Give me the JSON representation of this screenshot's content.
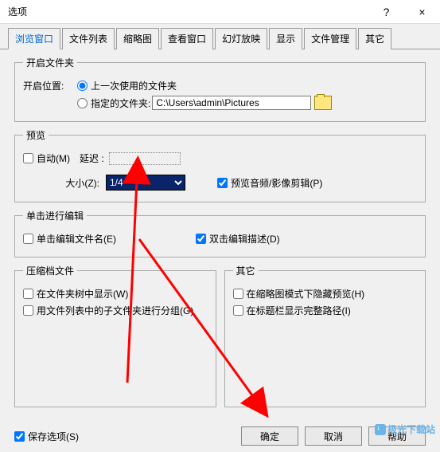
{
  "window": {
    "title": "选项",
    "help": "?",
    "close": "×"
  },
  "tabs": [
    "浏览窗口",
    "文件列表",
    "缩略图",
    "查看窗口",
    "幻灯放映",
    "显示",
    "文件管理",
    "其它"
  ],
  "folder": {
    "legend": "开启文件夹",
    "location_label": "开启位置:",
    "opt_last": "上一次使用的文件夹",
    "opt_spec": "指定的文件夹:",
    "path": "C:\\Users\\admin\\Pictures"
  },
  "preview": {
    "legend": "预览",
    "auto": "自动(M)",
    "delay_label": "延迟 :",
    "size_label": "大小(Z):",
    "size_value": "1/4",
    "av_clip": "预览音频/影像剪辑(P)"
  },
  "edit": {
    "legend": "单击进行编辑",
    "name": "单击编辑文件名(E)",
    "desc": "双击编辑描述(D)"
  },
  "archive": {
    "legend": "压缩档文件",
    "tree": "在文件夹树中显示(W)",
    "group": "用文件列表中的子文件夹进行分组(G)"
  },
  "other": {
    "legend": "其它",
    "hide": "在缩略图模式下隐藏预览(H)",
    "fullpath": "在标题栏显示完整路径(I)"
  },
  "bottom": {
    "save": "保存选项(S)",
    "ok": "确定",
    "cancel": "取消",
    "help": "帮助"
  },
  "watermark": "极光下载站"
}
